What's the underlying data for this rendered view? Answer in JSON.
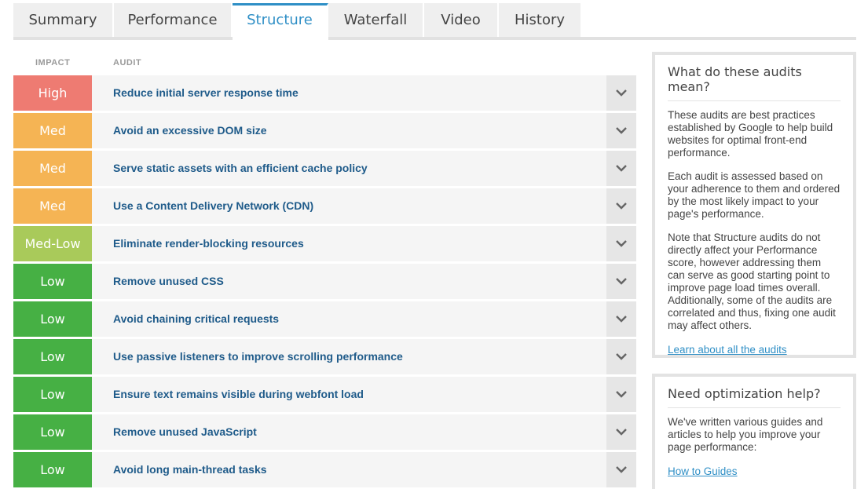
{
  "tabs": [
    {
      "label": "Summary"
    },
    {
      "label": "Performance"
    },
    {
      "label": "Structure"
    },
    {
      "label": "Waterfall"
    },
    {
      "label": "Video"
    },
    {
      "label": "History"
    }
  ],
  "active_tab": "Structure",
  "columns": {
    "impact": "IMPACT",
    "audit": "AUDIT"
  },
  "colors": {
    "high": "#ee7b72",
    "med": "#f5b454",
    "med_low": "#a9ca5a",
    "low": "#46b044",
    "accent": "#2f8fc6",
    "audit_text": "#1f5b8a"
  },
  "audits": [
    {
      "impact": "High",
      "level": "high",
      "title": "Reduce initial server response time"
    },
    {
      "impact": "Med",
      "level": "med",
      "title": "Avoid an excessive DOM size"
    },
    {
      "impact": "Med",
      "level": "med",
      "title": "Serve static assets with an efficient cache policy"
    },
    {
      "impact": "Med",
      "level": "med",
      "title": "Use a Content Delivery Network (CDN)"
    },
    {
      "impact": "Med-Low",
      "level": "med_low",
      "title": "Eliminate render-blocking resources"
    },
    {
      "impact": "Low",
      "level": "low",
      "title": "Remove unused CSS"
    },
    {
      "impact": "Low",
      "level": "low",
      "title": "Avoid chaining critical requests"
    },
    {
      "impact": "Low",
      "level": "low",
      "title": "Use passive listeners to improve scrolling performance"
    },
    {
      "impact": "Low",
      "level": "low",
      "title": "Ensure text remains visible during webfont load"
    },
    {
      "impact": "Low",
      "level": "low",
      "title": "Remove unused JavaScript"
    },
    {
      "impact": "Low",
      "level": "low",
      "title": "Avoid long main-thread tasks"
    }
  ],
  "expand_icon": "chevron-down-icon",
  "info_panel": {
    "title": "What do these audits mean?",
    "paragraphs": [
      "These audits are best practices established by Google to help build websites for optimal front-end performance.",
      "Each audit is assessed based on your adherence to them and ordered by the most likely impact to your page's performance.",
      "Note that Structure audits do not directly affect your Performance score, however addressing them can serve as good starting point to improve page load times overall. Additionally, some of the audits are correlated and thus, fixing one audit may affect others."
    ],
    "link": "Learn about all the audits"
  },
  "help_panel": {
    "title": "Need optimization help?",
    "paragraphs": [
      "We've written various guides and articles to help you improve your page performance:"
    ],
    "link": "How to Guides"
  }
}
